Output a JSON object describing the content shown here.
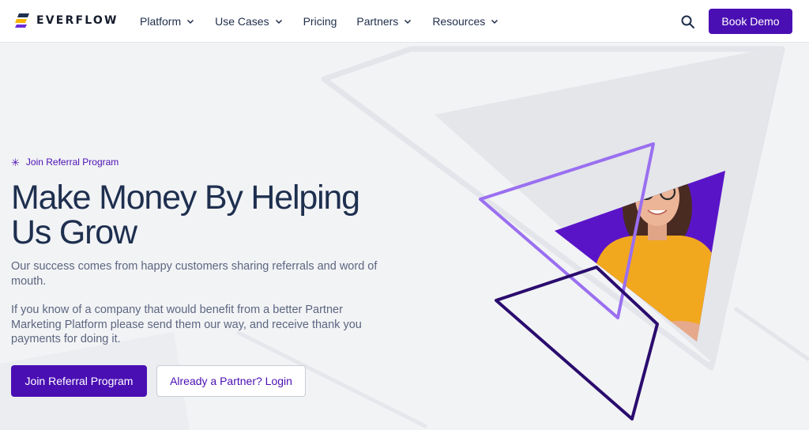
{
  "brand": {
    "name": "EVERFLOW",
    "logo_icon": "everflow-logo-icon",
    "accent": "#4a0fb3",
    "logo_colors": [
      "#1e2f4f",
      "#f7b500",
      "#6c2bd9"
    ]
  },
  "nav": {
    "items": [
      {
        "label": "Platform",
        "has_dropdown": true
      },
      {
        "label": "Use Cases",
        "has_dropdown": true
      },
      {
        "label": "Pricing",
        "has_dropdown": false
      },
      {
        "label": "Partners",
        "has_dropdown": true
      },
      {
        "label": "Resources",
        "has_dropdown": true
      }
    ],
    "search_icon": "search-icon",
    "cta_label": "Book Demo"
  },
  "hero": {
    "eyebrow": "Join Referral Program",
    "eyebrow_icon": "asterisk-icon",
    "title_line1": "Make Money By Helping",
    "title_line2": "Us Grow",
    "paragraph1": "Our success comes from happy customers sharing referrals and word of mouth.",
    "paragraph2": "If you know of a company that would benefit from a better Partner Marketing Platform please send them our way, and receive thank you payments for doing it.",
    "primary_cta": "Join Referral Program",
    "secondary_cta": "Already a Partner? Login",
    "image": "smiling-woman-with-glasses-in-yellow-sweater",
    "shape_colors": {
      "violet_outline": "#9a6ff0",
      "dark_outline": "#2a0c6e",
      "purple_fill": "#5a14c8",
      "grey_shape": "#e4e6ea"
    }
  }
}
